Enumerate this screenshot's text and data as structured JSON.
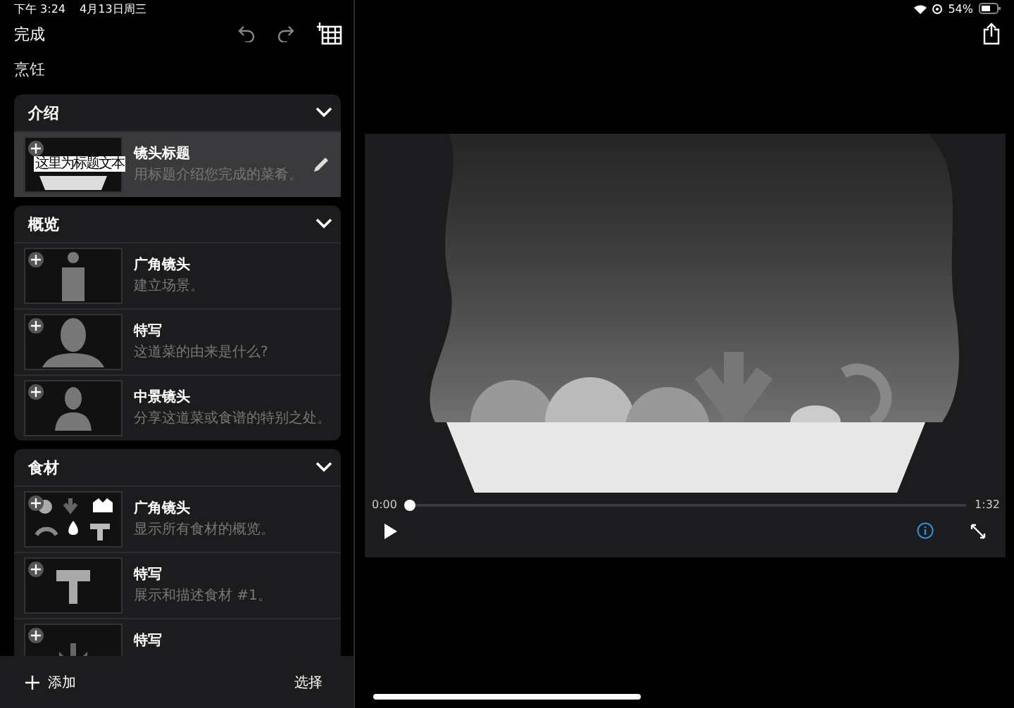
{
  "status_bar": {
    "time": "下午 3:24",
    "date": "4月13日周三",
    "battery": "54%"
  },
  "toolbar": {
    "done": "完成"
  },
  "project_title": "烹饪",
  "sections": [
    {
      "title": "介绍",
      "expanded": true,
      "shots": [
        {
          "kind": "title",
          "name": "镜头标题",
          "description": "用标题介绍您完成的菜肴。",
          "thumbnail_text": "这里为标题文本",
          "selected": true
        }
      ]
    },
    {
      "title": "概览",
      "expanded": true,
      "shots": [
        {
          "kind": "full-body",
          "name": "广角镜头",
          "description": "建立场景。",
          "selected": false
        },
        {
          "kind": "closeup",
          "name": "特写",
          "description": "这道菜的由来是什么?",
          "selected": false
        },
        {
          "kind": "medium",
          "name": "中景镜头",
          "description": "分享这道菜或食谱的特别之处。",
          "selected": false
        }
      ]
    },
    {
      "title": "食材",
      "expanded": true,
      "shots": [
        {
          "kind": "ingredients",
          "name": "广角镜头",
          "description": "显示所有食材的概览。",
          "selected": false
        },
        {
          "kind": "ingredient",
          "name": "特写",
          "description": "展示和描述食材 #1。",
          "selected": false
        },
        {
          "kind": "ingredient-2",
          "name": "特写",
          "selected": false
        }
      ]
    }
  ],
  "bottom_bar": {
    "add": "添加",
    "select": "选择"
  },
  "player": {
    "current_time": "0:00",
    "total_time": "1:32",
    "level": 0
  }
}
